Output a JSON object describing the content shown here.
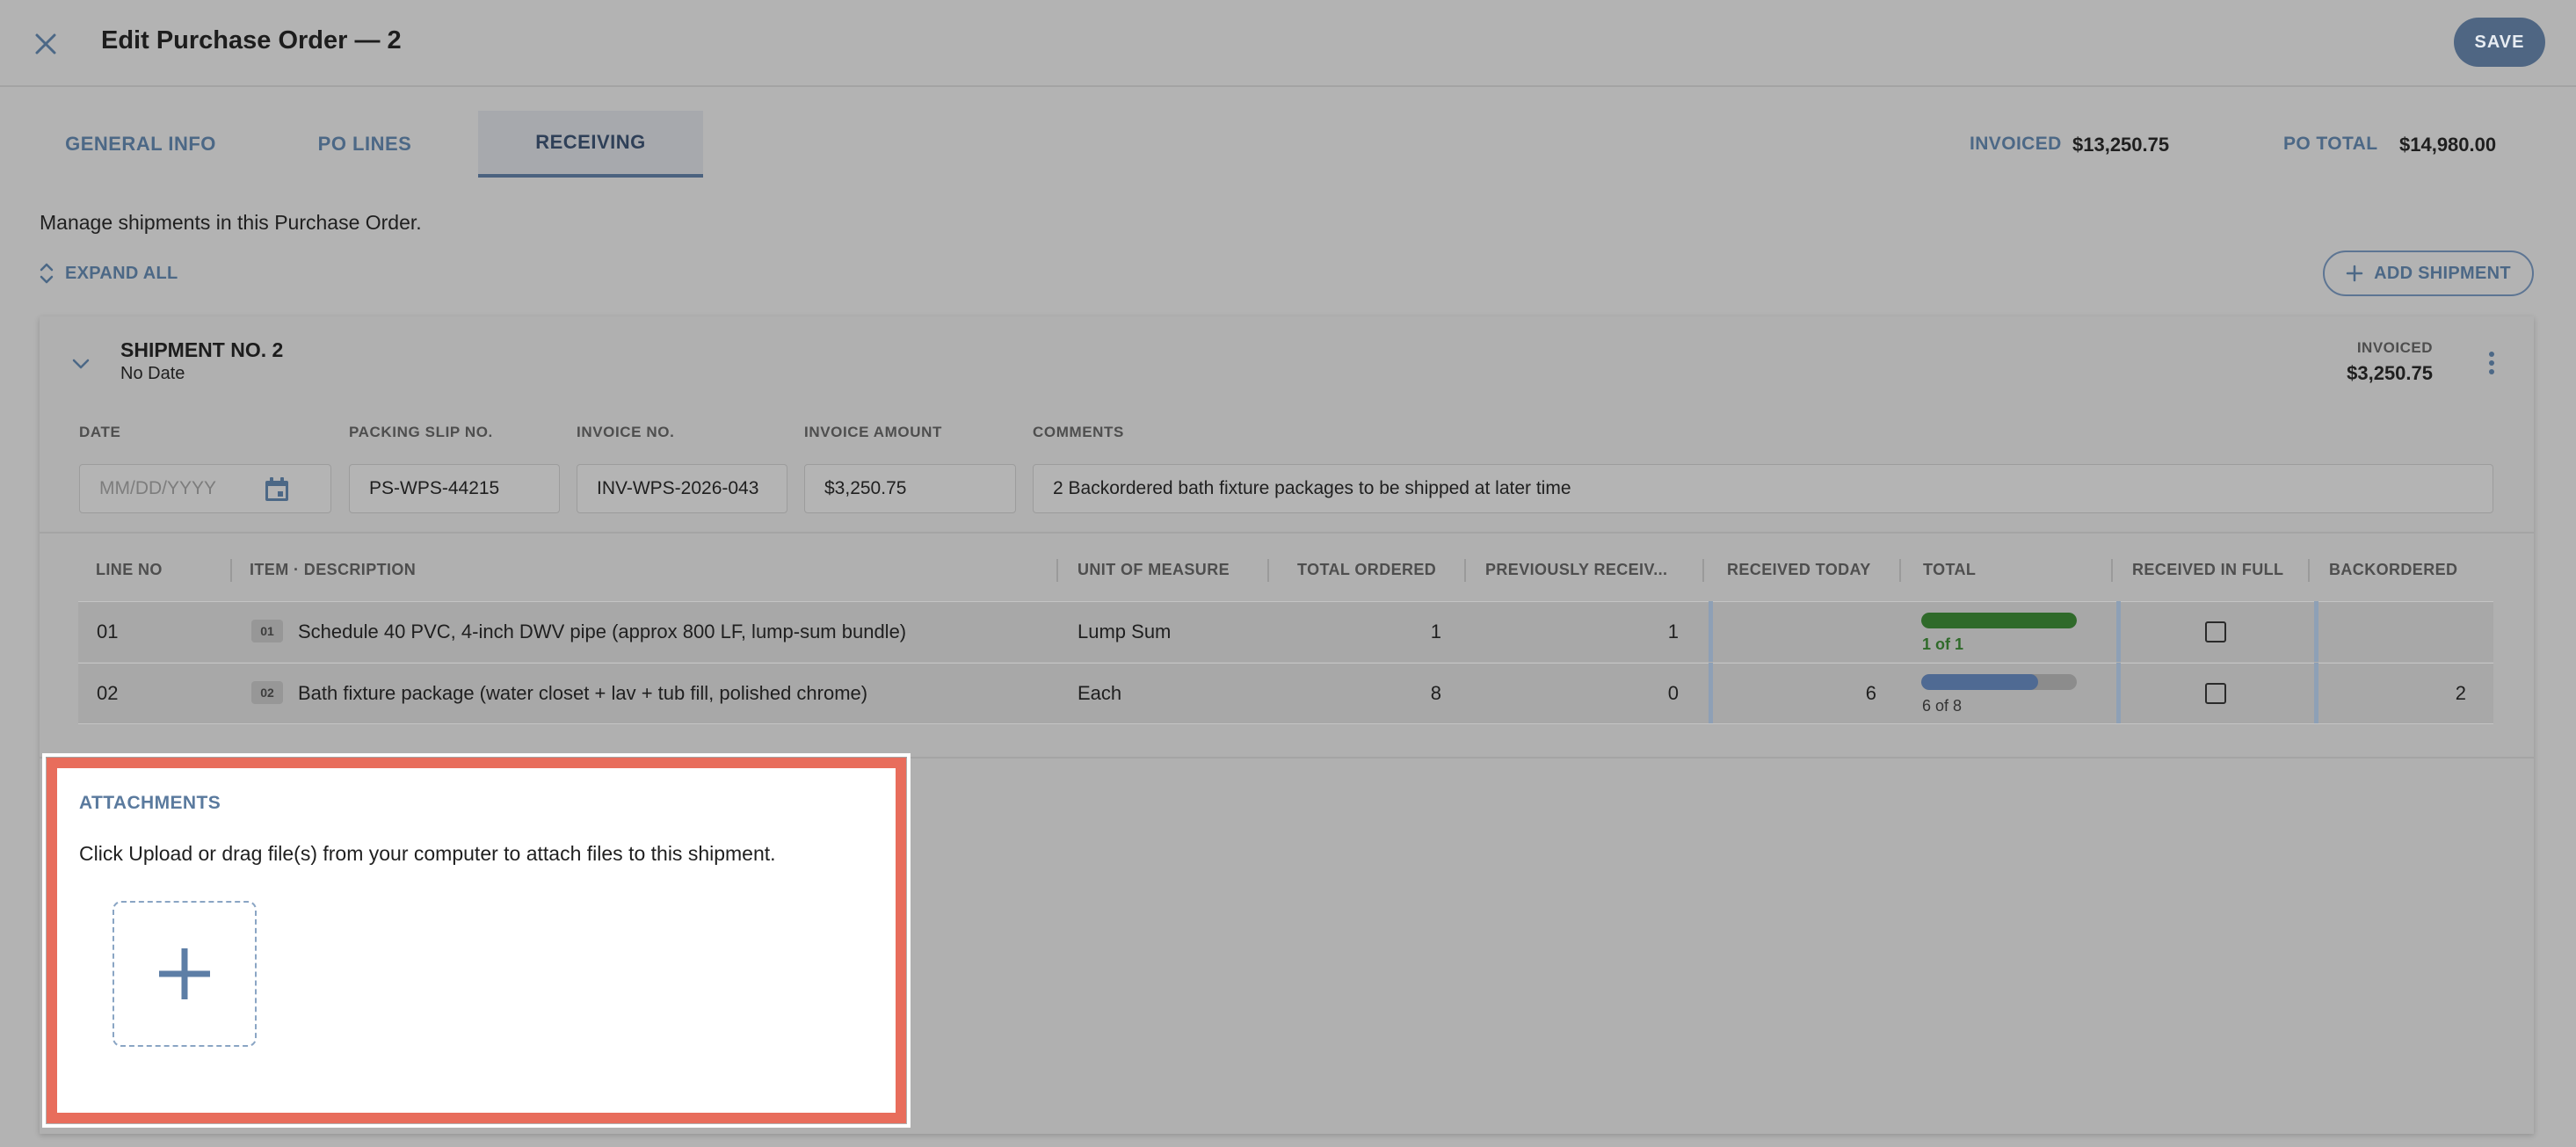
{
  "header": {
    "title": "Edit Purchase Order — 2",
    "save_label": "SAVE"
  },
  "tabs": [
    {
      "label": "GENERAL INFO"
    },
    {
      "label": "PO LINES"
    },
    {
      "label": "RECEIVING",
      "active": true
    }
  ],
  "summary": {
    "invoiced_label": "INVOICED",
    "invoiced_value": "$13,250.75",
    "po_total_label": "PO TOTAL",
    "po_total_value": "$14,980.00"
  },
  "receiving": {
    "description": "Manage shipments in this Purchase Order.",
    "expand_all_label": "EXPAND ALL",
    "add_shipment_label": "ADD SHIPMENT"
  },
  "shipment": {
    "title": "SHIPMENT NO. 2",
    "date_text": "No Date",
    "invoiced_label": "INVOICED",
    "invoiced_value": "$3,250.75",
    "fields": {
      "date_label": "DATE",
      "date_placeholder": "MM/DD/YYYY",
      "packing_label": "PACKING SLIP NO.",
      "packing_value": "PS-WPS-44215",
      "invoice_no_label": "INVOICE NO.",
      "invoice_no_value": "INV-WPS-2026-043",
      "invoice_amount_label": "INVOICE AMOUNT",
      "invoice_amount_value": "$3,250.75",
      "comments_label": "COMMENTS",
      "comments_value": "2 Backordered bath fixture packages to be shipped at later time"
    },
    "table": {
      "columns": [
        "LINE NO",
        "ITEM · DESCRIPTION",
        "UNIT OF MEASURE",
        "TOTAL ORDERED",
        "PREVIOUSLY RECEIV...",
        "RECEIVED TODAY",
        "TOTAL",
        "RECEIVED IN FULL",
        "BACKORDERED"
      ],
      "rows": [
        {
          "line_no": "01",
          "badge": "01",
          "description": "Schedule 40 PVC, 4-inch DWV pipe (approx 800 LF, lump-sum bundle)",
          "uom": "Lump Sum",
          "total_ordered": "1",
          "previously_received": "1",
          "received_today": "",
          "progress_label": "1 of 1",
          "progress_fraction": 1.0,
          "backordered": ""
        },
        {
          "line_no": "02",
          "badge": "02",
          "description": "Bath fixture package (water closet + lav + tub fill, polished chrome)",
          "uom": "Each",
          "total_ordered": "8",
          "previously_received": "0",
          "received_today": "6",
          "progress_label": "6 of 8",
          "progress_fraction": 0.75,
          "backordered": "2"
        }
      ]
    }
  },
  "attachments": {
    "title": "ATTACHMENTS",
    "description": "Click Upload or drag file(s) from your computer to attach files to this shipment."
  },
  "colors": {
    "accent": "#4f6683",
    "progress_complete": "#2f6a2a",
    "progress_partial": "#4f6a93",
    "highlight": "#e86d5c"
  }
}
